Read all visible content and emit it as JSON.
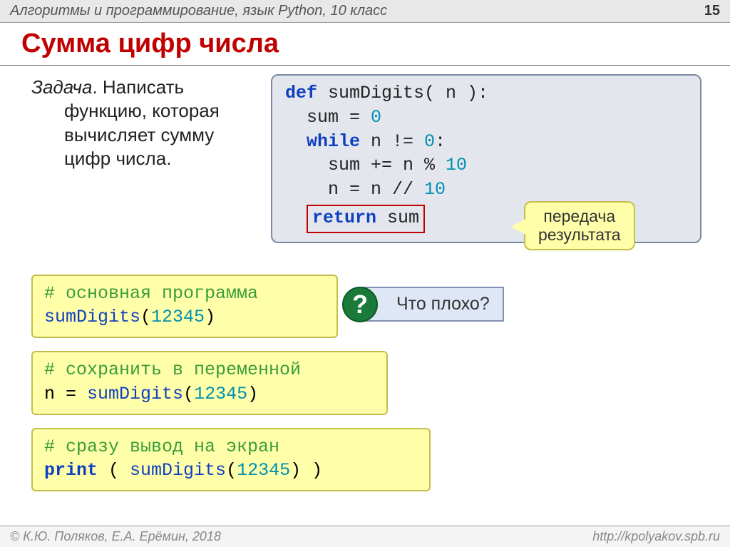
{
  "header": {
    "course": "Алгоритмы и программирование, язык Python, 10 класс",
    "page": "15"
  },
  "title": "Сумма цифр числа",
  "task": {
    "label": "Задача",
    "text_line1": ". Написать",
    "text_line2": "функцию, которая",
    "text_line3": "вычисляет сумму",
    "text_line4": "цифр числа."
  },
  "code": {
    "l1_def": "def",
    "l1_name": " sumDigits( n ):",
    "l2": "  sum",
    "l2_eq": " = ",
    "l2_v": "0",
    "l3_kw": "  while",
    "l3_rest": " n != ",
    "l3_v": "0",
    "l3_c": ":",
    "l4_a": "    sum += n % ",
    "l4_v": "10",
    "l5_a": "    n = n // ",
    "l5_v": "10",
    "ret_kw": "return",
    "ret_rest": " sum"
  },
  "callout": {
    "line1": "передача",
    "line2": "результата"
  },
  "snippets": {
    "s1_c": "# основная программа",
    "s1_code_fn": "sumDigits",
    "s1_code_arg": "12345",
    "s2_c": "# сохранить в переменной",
    "s2_pre": "n = ",
    "s2_fn": "sumDigits",
    "s2_arg": "12345",
    "s3_c": "# сразу вывод на экран",
    "s3_print": "print",
    "s3_fn": "sumDigits",
    "s3_arg": "12345"
  },
  "question": "Что плохо?",
  "footer": {
    "left": "© К.Ю. Поляков, Е.А. Ерёмин, 2018",
    "right": "http://kpolyakov.spb.ru"
  }
}
